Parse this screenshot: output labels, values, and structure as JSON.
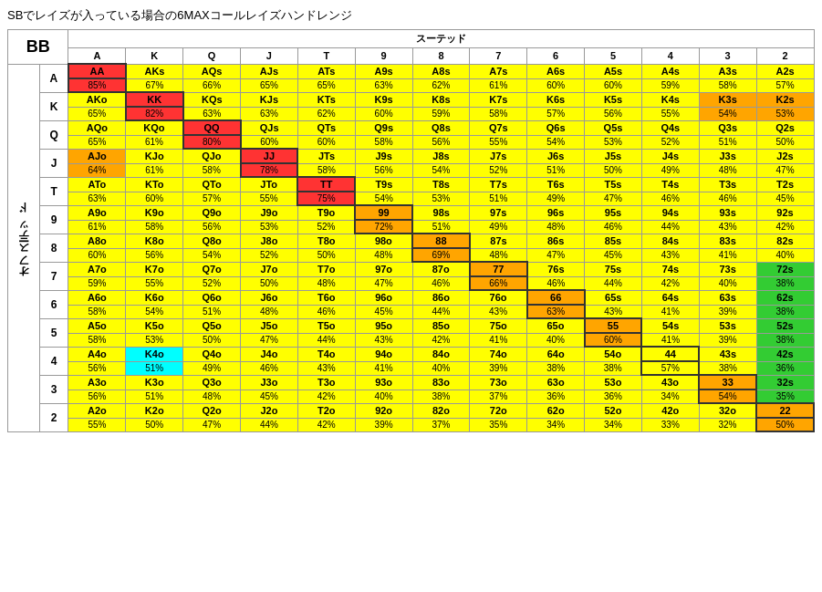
{
  "title": "SBでレイズが入っている場合の6MAXコールレイズハンドレンジ",
  "suited_label": "スーテッド",
  "offsuit_label": "オフスーテッド",
  "bb_label": "BB",
  "col_headers": [
    "A",
    "K",
    "Q",
    "J",
    "T",
    "9",
    "8",
    "7",
    "6",
    "5",
    "4",
    "3",
    "2"
  ],
  "row_headers": [
    "A",
    "K",
    "Q",
    "J",
    "T",
    "9",
    "8",
    "7",
    "6",
    "5",
    "4",
    "3",
    "2"
  ],
  "cells": [
    [
      {
        "top": "AA",
        "bot": "85%",
        "bg": "bg-red"
      },
      {
        "top": "AKs",
        "bot": "67%",
        "bg": "bg-yellow"
      },
      {
        "top": "AQs",
        "bot": "66%",
        "bg": "bg-yellow"
      },
      {
        "top": "AJs",
        "bot": "65%",
        "bg": "bg-yellow"
      },
      {
        "top": "ATs",
        "bot": "65%",
        "bg": "bg-yellow"
      },
      {
        "top": "A9s",
        "bot": "63%",
        "bg": "bg-yellow"
      },
      {
        "top": "A8s",
        "bot": "62%",
        "bg": "bg-yellow"
      },
      {
        "top": "A7s",
        "bot": "61%",
        "bg": "bg-yellow"
      },
      {
        "top": "A6s",
        "bot": "60%",
        "bg": "bg-yellow"
      },
      {
        "top": "A5s",
        "bot": "60%",
        "bg": "bg-yellow"
      },
      {
        "top": "A4s",
        "bot": "59%",
        "bg": "bg-yellow"
      },
      {
        "top": "A3s",
        "bot": "58%",
        "bg": "bg-yellow"
      },
      {
        "top": "A2s",
        "bot": "57%",
        "bg": "bg-yellow"
      }
    ],
    [
      {
        "top": "AKo",
        "bot": "65%",
        "bg": "bg-yellow"
      },
      {
        "top": "KK",
        "bot": "82%",
        "bg": "bg-red"
      },
      {
        "top": "KQs",
        "bot": "63%",
        "bg": "bg-yellow"
      },
      {
        "top": "KJs",
        "bot": "63%",
        "bg": "bg-yellow"
      },
      {
        "top": "KTs",
        "bot": "62%",
        "bg": "bg-yellow"
      },
      {
        "top": "K9s",
        "bot": "60%",
        "bg": "bg-yellow"
      },
      {
        "top": "K8s",
        "bot": "59%",
        "bg": "bg-yellow"
      },
      {
        "top": "K7s",
        "bot": "58%",
        "bg": "bg-yellow"
      },
      {
        "top": "K6s",
        "bot": "57%",
        "bg": "bg-yellow"
      },
      {
        "top": "K5s",
        "bot": "56%",
        "bg": "bg-yellow"
      },
      {
        "top": "K4s",
        "bot": "55%",
        "bg": "bg-yellow"
      },
      {
        "top": "K3s",
        "bot": "54%",
        "bg": "bg-orange"
      },
      {
        "top": "K2s",
        "bot": "53%",
        "bg": "bg-orange"
      }
    ],
    [
      {
        "top": "AQo",
        "bot": "65%",
        "bg": "bg-yellow"
      },
      {
        "top": "KQo",
        "bot": "61%",
        "bg": "bg-yellow"
      },
      {
        "top": "QQ",
        "bot": "80%",
        "bg": "bg-red"
      },
      {
        "top": "QJs",
        "bot": "60%",
        "bg": "bg-yellow"
      },
      {
        "top": "QTs",
        "bot": "60%",
        "bg": "bg-yellow"
      },
      {
        "top": "Q9s",
        "bot": "58%",
        "bg": "bg-yellow"
      },
      {
        "top": "Q8s",
        "bot": "56%",
        "bg": "bg-yellow"
      },
      {
        "top": "Q7s",
        "bot": "55%",
        "bg": "bg-yellow"
      },
      {
        "top": "Q6s",
        "bot": "54%",
        "bg": "bg-yellow"
      },
      {
        "top": "Q5s",
        "bot": "53%",
        "bg": "bg-yellow"
      },
      {
        "top": "Q4s",
        "bot": "52%",
        "bg": "bg-yellow"
      },
      {
        "top": "Q3s",
        "bot": "51%",
        "bg": "bg-yellow"
      },
      {
        "top": "Q2s",
        "bot": "50%",
        "bg": "bg-yellow"
      }
    ],
    [
      {
        "top": "AJo",
        "bot": "64%",
        "bg": "bg-orange"
      },
      {
        "top": "KJo",
        "bot": "61%",
        "bg": "bg-yellow"
      },
      {
        "top": "QJo",
        "bot": "58%",
        "bg": "bg-yellow"
      },
      {
        "top": "JJ",
        "bot": "78%",
        "bg": "bg-red"
      },
      {
        "top": "JTs",
        "bot": "58%",
        "bg": "bg-yellow"
      },
      {
        "top": "J9s",
        "bot": "56%",
        "bg": "bg-yellow"
      },
      {
        "top": "J8s",
        "bot": "54%",
        "bg": "bg-yellow"
      },
      {
        "top": "J7s",
        "bot": "52%",
        "bg": "bg-yellow"
      },
      {
        "top": "J6s",
        "bot": "51%",
        "bg": "bg-yellow"
      },
      {
        "top": "J5s",
        "bot": "50%",
        "bg": "bg-yellow"
      },
      {
        "top": "J4s",
        "bot": "49%",
        "bg": "bg-yellow"
      },
      {
        "top": "J3s",
        "bot": "48%",
        "bg": "bg-yellow"
      },
      {
        "top": "J2s",
        "bot": "47%",
        "bg": "bg-yellow"
      }
    ],
    [
      {
        "top": "ATo",
        "bot": "63%",
        "bg": "bg-yellow"
      },
      {
        "top": "KTo",
        "bot": "60%",
        "bg": "bg-yellow"
      },
      {
        "top": "QTo",
        "bot": "57%",
        "bg": "bg-yellow"
      },
      {
        "top": "JTo",
        "bot": "55%",
        "bg": "bg-yellow"
      },
      {
        "top": "TT",
        "bot": "75%",
        "bg": "bg-red"
      },
      {
        "top": "T9s",
        "bot": "54%",
        "bg": "bg-yellow"
      },
      {
        "top": "T8s",
        "bot": "53%",
        "bg": "bg-yellow"
      },
      {
        "top": "T7s",
        "bot": "51%",
        "bg": "bg-yellow"
      },
      {
        "top": "T6s",
        "bot": "49%",
        "bg": "bg-yellow"
      },
      {
        "top": "T5s",
        "bot": "47%",
        "bg": "bg-yellow"
      },
      {
        "top": "T4s",
        "bot": "46%",
        "bg": "bg-yellow"
      },
      {
        "top": "T3s",
        "bot": "46%",
        "bg": "bg-yellow"
      },
      {
        "top": "T2s",
        "bot": "45%",
        "bg": "bg-yellow"
      }
    ],
    [
      {
        "top": "A9o",
        "bot": "61%",
        "bg": "bg-yellow"
      },
      {
        "top": "K9o",
        "bot": "58%",
        "bg": "bg-yellow"
      },
      {
        "top": "Q9o",
        "bot": "56%",
        "bg": "bg-yellow"
      },
      {
        "top": "J9o",
        "bot": "53%",
        "bg": "bg-yellow"
      },
      {
        "top": "T9o",
        "bot": "52%",
        "bg": "bg-yellow"
      },
      {
        "top": "99",
        "bot": "72%",
        "bg": "bg-orange"
      },
      {
        "top": "98s",
        "bot": "51%",
        "bg": "bg-yellow"
      },
      {
        "top": "97s",
        "bot": "49%",
        "bg": "bg-yellow"
      },
      {
        "top": "96s",
        "bot": "48%",
        "bg": "bg-yellow"
      },
      {
        "top": "95s",
        "bot": "46%",
        "bg": "bg-yellow"
      },
      {
        "top": "94s",
        "bot": "44%",
        "bg": "bg-yellow"
      },
      {
        "top": "93s",
        "bot": "43%",
        "bg": "bg-yellow"
      },
      {
        "top": "92s",
        "bot": "42%",
        "bg": "bg-yellow"
      }
    ],
    [
      {
        "top": "A8o",
        "bot": "60%",
        "bg": "bg-yellow"
      },
      {
        "top": "K8o",
        "bot": "56%",
        "bg": "bg-yellow"
      },
      {
        "top": "Q8o",
        "bot": "54%",
        "bg": "bg-yellow"
      },
      {
        "top": "J8o",
        "bot": "52%",
        "bg": "bg-yellow"
      },
      {
        "top": "T8o",
        "bot": "50%",
        "bg": "bg-yellow"
      },
      {
        "top": "98o",
        "bot": "48%",
        "bg": "bg-yellow"
      },
      {
        "top": "88",
        "bot": "69%",
        "bg": "bg-orange"
      },
      {
        "top": "87s",
        "bot": "48%",
        "bg": "bg-yellow"
      },
      {
        "top": "86s",
        "bot": "47%",
        "bg": "bg-yellow"
      },
      {
        "top": "85s",
        "bot": "45%",
        "bg": "bg-yellow"
      },
      {
        "top": "84s",
        "bot": "43%",
        "bg": "bg-yellow"
      },
      {
        "top": "83s",
        "bot": "41%",
        "bg": "bg-yellow"
      },
      {
        "top": "82s",
        "bot": "40%",
        "bg": "bg-yellow"
      }
    ],
    [
      {
        "top": "A7o",
        "bot": "59%",
        "bg": "bg-yellow"
      },
      {
        "top": "K7o",
        "bot": "55%",
        "bg": "bg-yellow"
      },
      {
        "top": "Q7o",
        "bot": "52%",
        "bg": "bg-yellow"
      },
      {
        "top": "J7o",
        "bot": "50%",
        "bg": "bg-yellow"
      },
      {
        "top": "T7o",
        "bot": "48%",
        "bg": "bg-yellow"
      },
      {
        "top": "97o",
        "bot": "47%",
        "bg": "bg-yellow"
      },
      {
        "top": "87o",
        "bot": "46%",
        "bg": "bg-yellow"
      },
      {
        "top": "77",
        "bot": "66%",
        "bg": "bg-orange"
      },
      {
        "top": "76s",
        "bot": "46%",
        "bg": "bg-yellow"
      },
      {
        "top": "75s",
        "bot": "44%",
        "bg": "bg-yellow"
      },
      {
        "top": "74s",
        "bot": "42%",
        "bg": "bg-yellow"
      },
      {
        "top": "73s",
        "bot": "40%",
        "bg": "bg-yellow"
      },
      {
        "top": "72s",
        "bot": "38%",
        "bg": "bg-green"
      }
    ],
    [
      {
        "top": "A6o",
        "bot": "58%",
        "bg": "bg-yellow"
      },
      {
        "top": "K6o",
        "bot": "54%",
        "bg": "bg-yellow"
      },
      {
        "top": "Q6o",
        "bot": "51%",
        "bg": "bg-yellow"
      },
      {
        "top": "J6o",
        "bot": "48%",
        "bg": "bg-yellow"
      },
      {
        "top": "T6o",
        "bot": "46%",
        "bg": "bg-yellow"
      },
      {
        "top": "96o",
        "bot": "45%",
        "bg": "bg-yellow"
      },
      {
        "top": "86o",
        "bot": "44%",
        "bg": "bg-yellow"
      },
      {
        "top": "76o",
        "bot": "43%",
        "bg": "bg-yellow"
      },
      {
        "top": "66",
        "bot": "63%",
        "bg": "bg-orange"
      },
      {
        "top": "65s",
        "bot": "43%",
        "bg": "bg-yellow"
      },
      {
        "top": "64s",
        "bot": "41%",
        "bg": "bg-yellow"
      },
      {
        "top": "63s",
        "bot": "39%",
        "bg": "bg-yellow"
      },
      {
        "top": "62s",
        "bot": "38%",
        "bg": "bg-green"
      }
    ],
    [
      {
        "top": "A5o",
        "bot": "58%",
        "bg": "bg-yellow"
      },
      {
        "top": "K5o",
        "bot": "53%",
        "bg": "bg-yellow"
      },
      {
        "top": "Q5o",
        "bot": "50%",
        "bg": "bg-yellow"
      },
      {
        "top": "J5o",
        "bot": "47%",
        "bg": "bg-yellow"
      },
      {
        "top": "T5o",
        "bot": "44%",
        "bg": "bg-yellow"
      },
      {
        "top": "95o",
        "bot": "43%",
        "bg": "bg-yellow"
      },
      {
        "top": "85o",
        "bot": "42%",
        "bg": "bg-yellow"
      },
      {
        "top": "75o",
        "bot": "41%",
        "bg": "bg-yellow"
      },
      {
        "top": "65o",
        "bot": "40%",
        "bg": "bg-yellow"
      },
      {
        "top": "55",
        "bot": "60%",
        "bg": "bg-orange"
      },
      {
        "top": "54s",
        "bot": "41%",
        "bg": "bg-yellow"
      },
      {
        "top": "53s",
        "bot": "39%",
        "bg": "bg-yellow"
      },
      {
        "top": "52s",
        "bot": "38%",
        "bg": "bg-green"
      }
    ],
    [
      {
        "top": "A4o",
        "bot": "56%",
        "bg": "bg-yellow"
      },
      {
        "top": "K4o",
        "bot": "51%",
        "bg": "bg-cyan"
      },
      {
        "top": "Q4o",
        "bot": "49%",
        "bg": "bg-yellow"
      },
      {
        "top": "J4o",
        "bot": "46%",
        "bg": "bg-yellow"
      },
      {
        "top": "T4o",
        "bot": "43%",
        "bg": "bg-yellow"
      },
      {
        "top": "94o",
        "bot": "41%",
        "bg": "bg-yellow"
      },
      {
        "top": "84o",
        "bot": "40%",
        "bg": "bg-yellow"
      },
      {
        "top": "74o",
        "bot": "39%",
        "bg": "bg-yellow"
      },
      {
        "top": "64o",
        "bot": "38%",
        "bg": "bg-yellow"
      },
      {
        "top": "54o",
        "bot": "38%",
        "bg": "bg-yellow"
      },
      {
        "top": "44",
        "bot": "57%",
        "bg": "bg-yellow"
      },
      {
        "top": "43s",
        "bot": "38%",
        "bg": "bg-yellow"
      },
      {
        "top": "42s",
        "bot": "36%",
        "bg": "bg-green"
      }
    ],
    [
      {
        "top": "A3o",
        "bot": "56%",
        "bg": "bg-yellow"
      },
      {
        "top": "K3o",
        "bot": "51%",
        "bg": "bg-yellow"
      },
      {
        "top": "Q3o",
        "bot": "48%",
        "bg": "bg-yellow"
      },
      {
        "top": "J3o",
        "bot": "45%",
        "bg": "bg-yellow"
      },
      {
        "top": "T3o",
        "bot": "42%",
        "bg": "bg-yellow"
      },
      {
        "top": "93o",
        "bot": "40%",
        "bg": "bg-yellow"
      },
      {
        "top": "83o",
        "bot": "38%",
        "bg": "bg-yellow"
      },
      {
        "top": "73o",
        "bot": "37%",
        "bg": "bg-yellow"
      },
      {
        "top": "63o",
        "bot": "36%",
        "bg": "bg-yellow"
      },
      {
        "top": "53o",
        "bot": "36%",
        "bg": "bg-yellow"
      },
      {
        "top": "43o",
        "bot": "34%",
        "bg": "bg-yellow"
      },
      {
        "top": "33",
        "bot": "54%",
        "bg": "bg-orange"
      },
      {
        "top": "32s",
        "bot": "35%",
        "bg": "bg-green"
      }
    ],
    [
      {
        "top": "A2o",
        "bot": "55%",
        "bg": "bg-yellow"
      },
      {
        "top": "K2o",
        "bot": "50%",
        "bg": "bg-yellow"
      },
      {
        "top": "Q2o",
        "bot": "47%",
        "bg": "bg-yellow"
      },
      {
        "top": "J2o",
        "bot": "44%",
        "bg": "bg-yellow"
      },
      {
        "top": "T2o",
        "bot": "42%",
        "bg": "bg-yellow"
      },
      {
        "top": "92o",
        "bot": "39%",
        "bg": "bg-yellow"
      },
      {
        "top": "82o",
        "bot": "37%",
        "bg": "bg-yellow"
      },
      {
        "top": "72o",
        "bot": "35%",
        "bg": "bg-yellow"
      },
      {
        "top": "62o",
        "bot": "34%",
        "bg": "bg-yellow"
      },
      {
        "top": "52o",
        "bot": "34%",
        "bg": "bg-yellow"
      },
      {
        "top": "42o",
        "bot": "33%",
        "bg": "bg-yellow"
      },
      {
        "top": "32o",
        "bot": "32%",
        "bg": "bg-yellow"
      },
      {
        "top": "22",
        "bot": "50%",
        "bg": "bg-orange"
      }
    ]
  ]
}
